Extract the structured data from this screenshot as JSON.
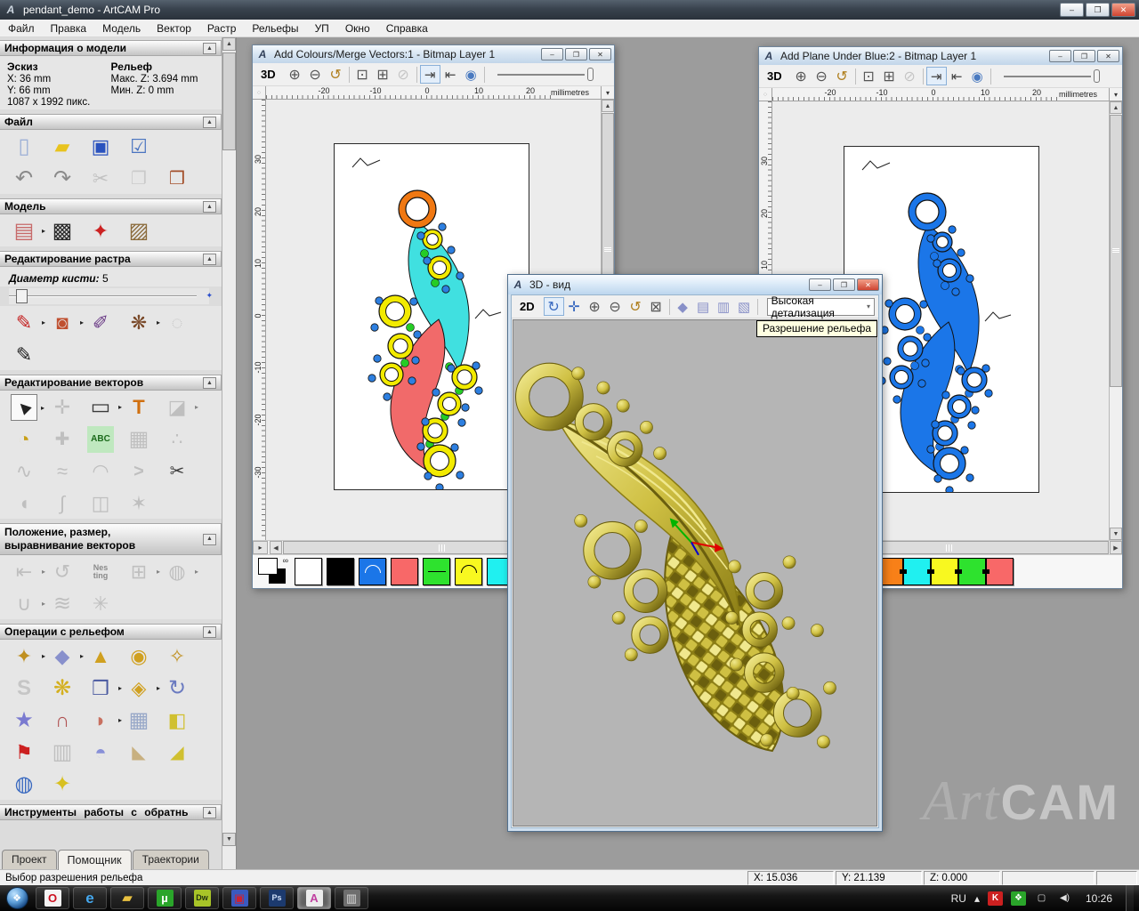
{
  "titlebar": {
    "title": "pendant_demo - ArtCAM Pro",
    "logo": "A",
    "min": "–",
    "max": "❐",
    "close": "✕"
  },
  "menu": {
    "items": [
      "Файл",
      "Правка",
      "Модель",
      "Вектор",
      "Растр",
      "Рельефы",
      "УП",
      "Окно",
      "Справка"
    ]
  },
  "sidebar": {
    "info": {
      "title": "Информация о модели",
      "sketch": "Эскиз",
      "relief": "Рельеф",
      "x": "X: 36 mm",
      "y": "Y: 66 mm",
      "maxz": "Макс. Z: 3.694 mm",
      "minz": "Мин. Z: 0 mm",
      "pixels": "1087 x 1992 пикс."
    },
    "sections": [
      {
        "title": "Файл",
        "rows": [
          [
            {
              "n": "new-model-icon",
              "g": "▯",
              "c": "#9db0d6",
              "fs": 24
            },
            {
              "n": "open-model-icon",
              "g": "▰",
              "c": "#e8c31e",
              "fs": 22
            },
            {
              "n": "save-model-icon",
              "g": "▣",
              "c": "#2a52be",
              "fs": 22
            },
            {
              "n": "model-setup-icon",
              "g": "☑",
              "c": "#4a74c0",
              "fs": 22
            }
          ],
          [
            {
              "n": "undo-icon",
              "g": "↶",
              "c": "#8a8a8a",
              "fs": 24
            },
            {
              "n": "redo-icon",
              "g": "↷",
              "c": "#8a8a8a",
              "fs": 24
            },
            {
              "n": "cut-icon",
              "g": "✂",
              "c": "#a0a0a0",
              "dim": true,
              "fs": 22
            },
            {
              "n": "copy-icon",
              "g": "❐",
              "c": "#b0b0b0",
              "dim": true,
              "fs": 20
            },
            {
              "n": "paste-icon",
              "g": "❒",
              "c": "#a34f2a",
              "fs": 20
            }
          ]
        ]
      },
      {
        "title": "Модель",
        "rows": [
          [
            {
              "n": "set-model-size-icon",
              "g": "▤",
              "c": "#c76a6a",
              "fly": true,
              "fs": 24
            },
            {
              "n": "adjust-model-icon",
              "g": "▩",
              "c": "#2a2a2a",
              "fs": 24
            },
            {
              "n": "lighting-icon",
              "g": "✦",
              "c": "#cc2222",
              "fs": 22
            },
            {
              "n": "load-texture-icon",
              "g": "▨",
              "c": "#8a6a3a",
              "fs": 24
            }
          ]
        ]
      },
      {
        "title": "Редактирование растра",
        "brush_label": "Диаметр кисти:",
        "brush_value": "5",
        "rows": [
          [
            {
              "n": "paint-icon",
              "g": "✎",
              "c": "#c42020",
              "fly": true,
              "fs": 22
            },
            {
              "n": "flood-fill-icon",
              "g": "◙",
              "c": "#c05030",
              "fly": true,
              "fs": 22
            },
            {
              "n": "colour-picker-icon",
              "g": "✐",
              "c": "#6a3a86",
              "fs": 22
            },
            {
              "n": "palette-icon",
              "g": "❋",
              "c": "#7a4a2a",
              "fly": true,
              "fs": 22
            },
            {
              "n": "eraser-icon",
              "g": "◌",
              "c": "#a8a8a8",
              "dim": true,
              "fs": 22
            }
          ],
          [
            {
              "n": "draw-icon",
              "g": "✎",
              "c": "#1a1a1a",
              "fs": 22
            }
          ]
        ]
      },
      {
        "title": "Редактирование векторов",
        "rows": [
          [
            {
              "n": "select-vectors-icon",
              "g": "▶",
              "c": "#222222",
              "box": true,
              "rot": -135,
              "fs": 16,
              "fly": true
            },
            {
              "n": "transform-vectors-icon",
              "g": "✛",
              "c": "#9a9a9a",
              "dim": true,
              "fs": 22
            },
            {
              "n": "create-rectangle-icon",
              "g": "▭",
              "c": "#3a3a3a",
              "fly": true,
              "fs": 24
            },
            {
              "n": "create-text-icon",
              "g": "T",
              "c": "#d07010",
              "bold": true,
              "fs": 22
            },
            {
              "n": "trim-vectors-icon",
              "g": "◪",
              "c": "#9a9a9a",
              "dim": true,
              "fly": true,
              "fs": 22
            }
          ],
          [
            {
              "n": "measure-icon",
              "g": "◔",
              "c": "#c8a018",
              "fs": 22
            },
            {
              "n": "merge-vectors-icon",
              "g": "✚",
              "c": "#9a9a9a",
              "dim": true,
              "fs": 20
            },
            {
              "n": "paste-text-icon",
              "g": "ABC",
              "c": "#1a6a1a",
              "bg": "#bfe8bf",
              "bold": true,
              "fs": 10
            },
            {
              "n": "envelope-distort-icon",
              "g": "▦",
              "c": "#9a9a9a",
              "dim": true,
              "fs": 24
            },
            {
              "n": "scatter-copies-icon",
              "g": "∴",
              "c": "#9a9a9a",
              "dim": true,
              "fs": 20
            }
          ],
          [
            {
              "n": "node-editing-icon",
              "g": "∿",
              "c": "#9a9a9a",
              "dim": true,
              "fs": 22
            },
            {
              "n": "smooth-nodes-icon",
              "g": "≈",
              "c": "#9a9a9a",
              "dim": true,
              "fs": 22
            },
            {
              "n": "fit-arcs-icon",
              "g": "◠",
              "c": "#9a9a9a",
              "dim": true,
              "fs": 22
            },
            {
              "n": "fit-lines-icon",
              "g": ">",
              "c": "#9a9a9a",
              "dim": true,
              "bold": true,
              "fs": 20
            },
            {
              "n": "vector-scissors-icon",
              "g": "✂",
              "c": "#3a3a3a",
              "fs": 20
            }
          ],
          [
            {
              "n": "fillet-icon",
              "g": "◖",
              "c": "#9a9a9a",
              "dim": true,
              "fs": 22
            },
            {
              "n": "bend-vectors-icon",
              "g": "∫",
              "c": "#9a9a9a",
              "dim": true,
              "fs": 22
            },
            {
              "n": "mirror-vectors-icon",
              "g": "◫",
              "c": "#9a9a9a",
              "dim": true,
              "fs": 22
            },
            {
              "n": "vector-texture-icon",
              "g": "✶",
              "c": "#9a9a9a",
              "dim": true,
              "fs": 22
            }
          ]
        ]
      },
      {
        "title": "Положение,  размер,  выравнивание векторов",
        "rows": [
          [
            {
              "n": "align-vectors-icon",
              "g": "⇤",
              "c": "#9a9a9a",
              "dim": true,
              "fly": true,
              "fs": 22
            },
            {
              "n": "text-on-curve-icon",
              "g": "↺",
              "c": "#9a9a9a",
              "dim": true,
              "fs": 22
            },
            {
              "n": "nesting-icon",
              "g": "Nes\nting",
              "c": "#8a8a8a",
              "bold": true,
              "fs": 9
            },
            {
              "n": "block-copy-icon",
              "g": "⊞",
              "c": "#9a9a9a",
              "dim": true,
              "fly": true,
              "fs": 22
            },
            {
              "n": "boolean-ops-icon",
              "g": "◍",
              "c": "#9a9a9a",
              "dim": true,
              "fly": true,
              "fs": 22
            }
          ],
          [
            {
              "n": "join-vectors-icon",
              "g": "∪",
              "c": "#9a9a9a",
              "dim": true,
              "fly": true,
              "fs": 22
            },
            {
              "n": "wave-distort-icon",
              "g": "≋",
              "c": "#9a9a9a",
              "dim": true,
              "fs": 24
            },
            {
              "n": "spiral-icon",
              "g": "✳",
              "c": "#9a9a9a",
              "dim": true,
              "fs": 22
            }
          ]
        ]
      },
      {
        "title": "Операции с рельефом",
        "rows": [
          [
            {
              "n": "calculate-relief-icon",
              "g": "✦",
              "c": "#c09020",
              "fly": true,
              "fs": 22
            },
            {
              "n": "zero-plane-icon",
              "g": "◆",
              "c": "#8890cc",
              "fly": true,
              "fs": 22
            },
            {
              "n": "add-relief-icon",
              "g": "▲",
              "c": "#d0a020",
              "fs": 22
            },
            {
              "n": "merge-high-icon",
              "g": "◉",
              "c": "#d0a020",
              "fs": 22
            },
            {
              "n": "merge-low-icon",
              "g": "✧",
              "c": "#c09020",
              "fs": 22
            }
          ],
          [
            {
              "n": "sculpt-icon",
              "g": "S",
              "c": "#a8a8a8",
              "dim": true,
              "bold": true,
              "fs": 24
            },
            {
              "n": "weave-wizard-icon",
              "g": "❋",
              "c": "#d4b020",
              "fs": 24
            },
            {
              "n": "emboss-wizard-icon",
              "g": "❒",
              "c": "#4a5aa0",
              "fly": true,
              "fs": 22
            },
            {
              "n": "two-rail-sweep-icon",
              "g": "◈",
              "c": "#d0a020",
              "fly": true,
              "fs": 22
            },
            {
              "n": "invert-relief-icon",
              "g": "↻",
              "c": "#6a7ac0",
              "fs": 24
            }
          ],
          [
            {
              "n": "star-wizard-icon",
              "g": "★",
              "c": "#7a7ad0",
              "fs": 24
            },
            {
              "n": "wrap-relief-icon",
              "g": "∩",
              "c": "#b05050",
              "fs": 22
            },
            {
              "n": "texture-curl-icon",
              "g": "◗",
              "c": "#c87060",
              "fly": true,
              "fs": 22
            },
            {
              "n": "face-wizard-icon",
              "g": "▦",
              "c": "#98a8c8",
              "fs": 24
            },
            {
              "n": "offset-relief-icon",
              "g": "◧",
              "c": "#d0c030",
              "fs": 22
            }
          ],
          [
            {
              "n": "greyscale-relief-icon",
              "g": "⚑",
              "c": "#cc2020",
              "fs": 22
            },
            {
              "n": "distort-relief-icon",
              "g": "▥",
              "c": "#9a9a9a",
              "dim": true,
              "fs": 24
            },
            {
              "n": "dome-relief-icon",
              "g": "◓",
              "c": "#8890d8",
              "fs": 22
            },
            {
              "n": "slice-relief-icon",
              "g": "◣",
              "c": "#c8b080",
              "fs": 20
            },
            {
              "n": "angle-relief-icon",
              "g": "◢",
              "c": "#d0c030",
              "fs": 20
            }
          ],
          [
            {
              "n": "mesh-globe-icon",
              "g": "◍",
              "c": "#3a6ac0",
              "fs": 24
            },
            {
              "n": "fold-relief-icon",
              "g": "✦",
              "c": "#d8c020",
              "fs": 24
            }
          ]
        ]
      }
    ],
    "bottom_section": "Инструменты  работы  с  обратным",
    "tabs": [
      {
        "label": "Проект"
      },
      {
        "label": "Помощник",
        "active": true
      },
      {
        "label": "Траектории"
      }
    ]
  },
  "ruler": {
    "h": [
      "-20",
      "-10",
      "0",
      "10",
      "20"
    ],
    "v": [
      "30",
      "20",
      "10",
      "0",
      "-10",
      "-20",
      "-30"
    ],
    "unit": "millimetres"
  },
  "toolbar2d": [
    {
      "n": "zoom-in-icon",
      "g": "⊕",
      "c": "#555555",
      "fs": 16
    },
    {
      "n": "zoom-out-icon",
      "g": "⊖",
      "c": "#555555",
      "fs": 16
    },
    {
      "n": "zoom-previous-icon",
      "g": "↺",
      "c": "#b08020",
      "fs": 16
    },
    {
      "sep": true
    },
    {
      "n": "zoom-1to1-icon",
      "g": "⊡",
      "c": "#555555",
      "fs": 16
    },
    {
      "n": "zoom-objects-icon",
      "g": "⊞",
      "c": "#555555",
      "fs": 16
    },
    {
      "n": "zoom-selected-icon",
      "g": "⊘",
      "c": "#999999",
      "dim": true,
      "fs": 16
    },
    {
      "sep": true
    },
    {
      "n": "toggle-bitmap-icon",
      "g": "⇥",
      "c": "#444444",
      "box": true,
      "fs": 15
    },
    {
      "n": "toggle-vector-icon",
      "g": "⇤",
      "c": "#444444",
      "fs": 15
    },
    {
      "n": "preview-relief-icon",
      "g": "◉",
      "c": "#4a7ac0",
      "fs": 15
    },
    {
      "sep": true
    }
  ],
  "toolbar3d": [
    {
      "n": "rotate-view-icon",
      "g": "↻",
      "c": "#3a6ac0",
      "box": true,
      "fs": 16
    },
    {
      "n": "pan-view-icon",
      "g": "✛",
      "c": "#3a6ac0",
      "fs": 16
    },
    {
      "n": "zoom-in-icon",
      "g": "⊕",
      "c": "#555555",
      "fs": 16
    },
    {
      "n": "zoom-out-icon",
      "g": "⊖",
      "c": "#555555",
      "fs": 16
    },
    {
      "n": "zoom-previous-icon",
      "g": "↺",
      "c": "#b08020",
      "fs": 16
    },
    {
      "n": "zoom-extents-icon",
      "g": "⊠",
      "c": "#555555",
      "fs": 16
    },
    {
      "sep": true
    },
    {
      "n": "iso-view-icon",
      "g": "◆",
      "c": "#8890c8",
      "fs": 15
    },
    {
      "n": "front-view-icon",
      "g": "▤",
      "c": "#8890c8",
      "fs": 15
    },
    {
      "n": "side-view-icon",
      "g": "▥",
      "c": "#8890c8",
      "fs": 15
    },
    {
      "n": "top-view-icon",
      "g": "▧",
      "c": "#8890c8",
      "fs": 15
    },
    {
      "sep": true
    }
  ],
  "win1": {
    "title": "Add Colours/Merge Vectors:1 - Bitmap Layer 1",
    "mode_button": "3D",
    "palette": [
      {
        "c": "#ffffff"
      },
      {
        "c": "#000000"
      },
      {
        "c": "#1b76e8",
        "mark": "arc",
        "markc": "#ffffff"
      },
      {
        "c": "#f86868"
      },
      {
        "c": "#2ee22e",
        "mark": "line",
        "markc": "#000000"
      },
      {
        "c": "#f8f820",
        "mark": "arc",
        "markc": "#000000"
      },
      {
        "c": "#20f0f0"
      }
    ]
  },
  "win2": {
    "title": "Add Plane Under Blue:2 - Bitmap Layer 1",
    "mode_button": "3D",
    "palette": [
      {
        "c": "#1b76e8",
        "mark": "line",
        "markc": "#ffffff",
        "link": true
      },
      {
        "c": "#f88018",
        "link": true
      },
      {
        "c": "#20f0f0",
        "link": true
      },
      {
        "c": "#f8f820",
        "link": true
      },
      {
        "c": "#2ee22e",
        "link": true
      },
      {
        "c": "#f86868",
        "link": true
      }
    ]
  },
  "win3d": {
    "title": "3D - вид",
    "mode_button": "2D",
    "detail": "Высокая детализация",
    "tooltip": "Разрешение рельефа"
  },
  "statusbar": {
    "message": "Выбор разрешения рельефа",
    "x": "X: 15.036",
    "y": "Y: 21.139",
    "z": "Z: 0.000"
  },
  "taskbar": {
    "apps": [
      {
        "n": "opera-icon",
        "g": "O",
        "c": "#cc1020",
        "bg": "#f4f4f4",
        "bold": true,
        "fs": 13
      },
      {
        "n": "ie-icon",
        "g": "e",
        "c": "#45a8ee",
        "bold": true,
        "fs": 17
      },
      {
        "n": "explorer-icon",
        "g": "▰",
        "c": "#e8c040",
        "fs": 15
      },
      {
        "n": "utorrent-icon",
        "g": "µ",
        "c": "#ffffff",
        "bg": "#2aa52a",
        "bold": true,
        "fs": 13
      },
      {
        "n": "dreamweaver-icon",
        "g": "Dw",
        "c": "#203010",
        "bg": "#a8c428",
        "bold": true,
        "fs": 9
      },
      {
        "n": "save-tool-icon",
        "g": "▣",
        "c": "#cc2233",
        "bg": "#3a5ac0",
        "fs": 13
      },
      {
        "n": "photoshop-icon",
        "g": "Ps",
        "c": "#cfe0f8",
        "bg": "#1c3a6e",
        "bold": true,
        "fs": 9
      },
      {
        "n": "artcam-icon",
        "g": "A",
        "c": "#c040a0",
        "bg": "#ececec",
        "bold": true,
        "active": true,
        "fs": 13
      },
      {
        "n": "viewer-icon",
        "g": "▥",
        "c": "#d8d8d8",
        "bg": "#6e6e6e",
        "fs": 13
      }
    ],
    "tray": [
      {
        "n": "language-indicator",
        "g": "RU",
        "text": true
      },
      {
        "n": "tray-expand-icon",
        "g": "▴",
        "text": true
      },
      {
        "n": "kaspersky-icon",
        "g": "K",
        "c": "#ffffff",
        "bg": "#cc2020",
        "bold": true
      },
      {
        "n": "tortoisehg-icon",
        "g": "❖",
        "c": "#ffffff",
        "bg": "#2aa52a"
      },
      {
        "n": "network-icon",
        "g": "▢",
        "c": "#e0e0e0"
      },
      {
        "n": "volume-icon",
        "g": "◀)",
        "c": "#e0e0e0"
      }
    ],
    "clock": "10:26",
    "start": "❖"
  },
  "watermark": {
    "p1": "Art",
    "p2": "CAM"
  },
  "art2d": {
    "cyan": "#40e0e0",
    "red": "#f16a6a",
    "yellow": "#f2ea00",
    "orange": "#f07812",
    "blue": "#1b76e8",
    "green": "#25cc25",
    "dot": "#2d7fe0"
  },
  "art3d": {
    "light": "#f0e88e",
    "mid": "#cfc043",
    "dark": "#8a7c14",
    "deep": "#6b5f0e",
    "axis_g": "#00b400",
    "axis_r": "#e00000",
    "axis_b": "#0000d0"
  }
}
